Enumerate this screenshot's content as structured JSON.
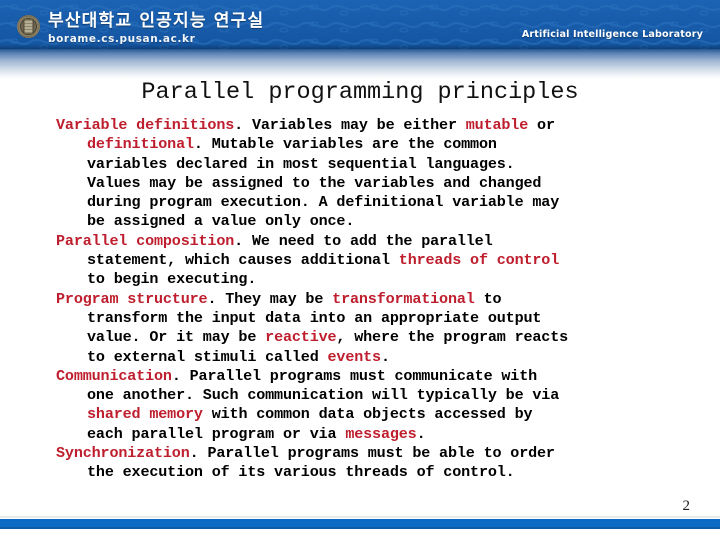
{
  "header": {
    "logo_icon": "university-seal-icon",
    "organization_korean": "부산대학교 인공지능 연구실",
    "organization_url": "borame.cs.pusan.ac.kr",
    "lab_name": "Artificial Intelligence Laboratory",
    "banner_color": "#175CAB"
  },
  "slide": {
    "title": "Parallel programming principles",
    "page_number": "2",
    "accent_color": "#be1e2d",
    "footer_bar_color": "#0a6ac4",
    "paragraphs": [
      {
        "id": "variable-definitions",
        "lines": [
          {
            "indent": false,
            "runs": [
              {
                "t": "Variable definitions",
                "hl": true
              },
              {
                "t": ". Variables may be either ",
                "hl": false
              },
              {
                "t": "mutable",
                "hl": true
              },
              {
                "t": " or",
                "hl": false
              }
            ]
          },
          {
            "indent": true,
            "runs": [
              {
                "t": "definitional",
                "hl": true
              },
              {
                "t": ". Mutable variables are the common",
                "hl": false
              }
            ]
          },
          {
            "indent": true,
            "runs": [
              {
                "t": "variables declared in most sequential languages.",
                "hl": false
              }
            ]
          },
          {
            "indent": true,
            "runs": [
              {
                "t": "Values may be assigned to the variables and changed",
                "hl": false
              }
            ]
          },
          {
            "indent": true,
            "runs": [
              {
                "t": "during program execution. A definitional variable may",
                "hl": false
              }
            ]
          },
          {
            "indent": true,
            "runs": [
              {
                "t": "be assigned a value only once.",
                "hl": false
              }
            ]
          }
        ]
      },
      {
        "id": "parallel-composition",
        "lines": [
          {
            "indent": false,
            "runs": [
              {
                "t": "Parallel composition",
                "hl": true
              },
              {
                "t": ". We need to add the parallel",
                "hl": false
              }
            ]
          },
          {
            "indent": true,
            "runs": [
              {
                "t": "statement, which causes additional ",
                "hl": false
              },
              {
                "t": "threads of control",
                "hl": true
              }
            ]
          },
          {
            "indent": true,
            "runs": [
              {
                "t": "to begin executing.",
                "hl": false
              }
            ]
          }
        ]
      },
      {
        "id": "program-structure",
        "lines": [
          {
            "indent": false,
            "runs": [
              {
                "t": "Program structure",
                "hl": true
              },
              {
                "t": ". They may be ",
                "hl": false
              },
              {
                "t": "transformational",
                "hl": true
              },
              {
                "t": " to",
                "hl": false
              }
            ]
          },
          {
            "indent": true,
            "runs": [
              {
                "t": "transform the input data into an appropriate output",
                "hl": false
              }
            ]
          },
          {
            "indent": true,
            "runs": [
              {
                "t": "value. Or it may be ",
                "hl": false
              },
              {
                "t": "reactive",
                "hl": true
              },
              {
                "t": ", where the program reacts",
                "hl": false
              }
            ]
          },
          {
            "indent": true,
            "runs": [
              {
                "t": "to external stimuli called ",
                "hl": false
              },
              {
                "t": "events",
                "hl": true
              },
              {
                "t": ".",
                "hl": false
              }
            ]
          }
        ]
      },
      {
        "id": "communication",
        "lines": [
          {
            "indent": false,
            "runs": [
              {
                "t": "Communication",
                "hl": true
              },
              {
                "t": ". Parallel programs must communicate with",
                "hl": false
              }
            ]
          },
          {
            "indent": true,
            "runs": [
              {
                "t": "one another. Such communication will typically be via",
                "hl": false
              }
            ]
          },
          {
            "indent": true,
            "runs": [
              {
                "t": "shared memory",
                "hl": true
              },
              {
                "t": " with common data objects accessed by",
                "hl": false
              }
            ]
          },
          {
            "indent": true,
            "runs": [
              {
                "t": "each parallel program or via ",
                "hl": false
              },
              {
                "t": "messages",
                "hl": true
              },
              {
                "t": ".",
                "hl": false
              }
            ]
          }
        ]
      },
      {
        "id": "synchronization",
        "lines": [
          {
            "indent": false,
            "runs": [
              {
                "t": "Synchronization",
                "hl": true
              },
              {
                "t": ". Parallel programs must be able to order",
                "hl": false
              }
            ]
          },
          {
            "indent": true,
            "runs": [
              {
                "t": "the execution of its various threads of control.",
                "hl": false
              }
            ]
          }
        ]
      }
    ]
  }
}
